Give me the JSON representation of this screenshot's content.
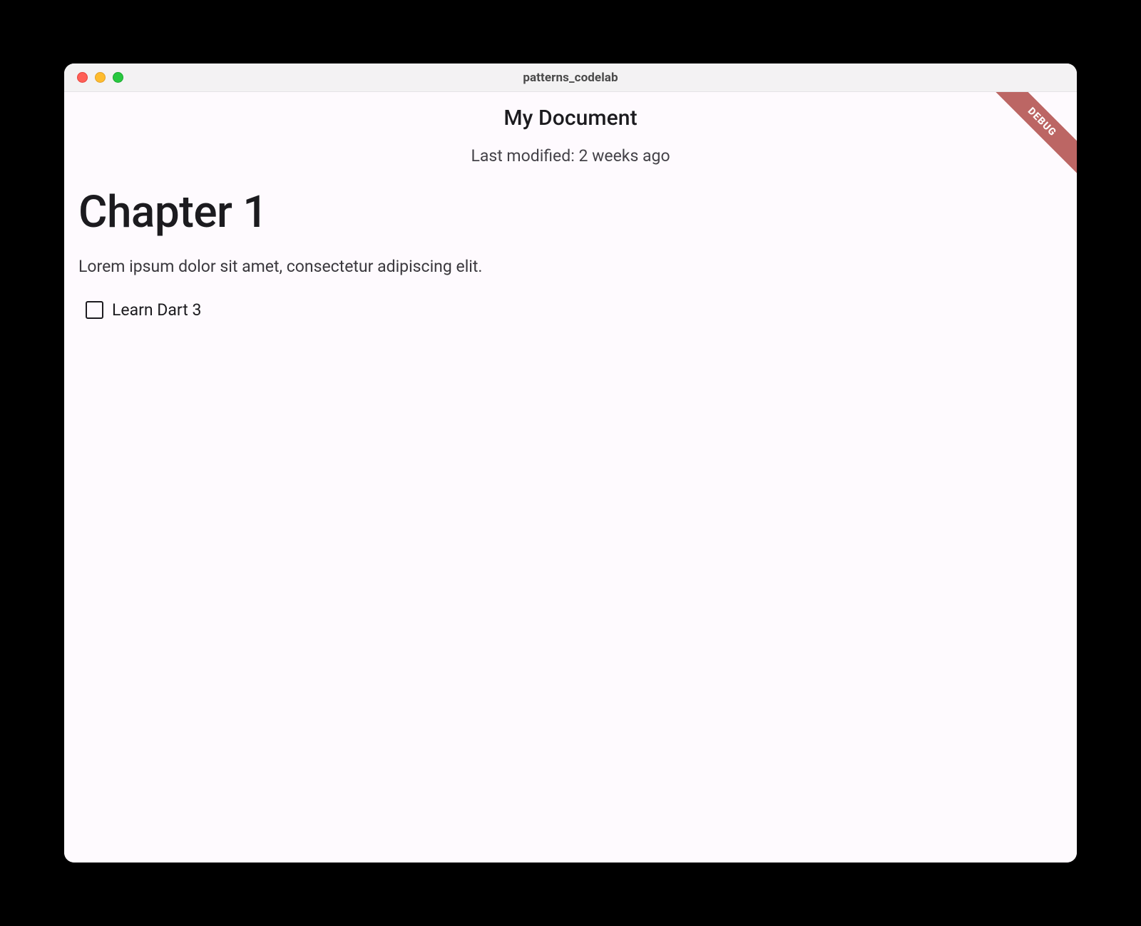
{
  "window": {
    "title": "patterns_codelab"
  },
  "appbar": {
    "title": "My Document"
  },
  "meta": {
    "last_modified": "Last modified: 2 weeks ago"
  },
  "blocks": {
    "heading": "Chapter 1",
    "paragraph": "Lorem ipsum dolor sit amet, consectetur adipiscing elit.",
    "checkbox_label": "Learn Dart 3",
    "checkbox_checked": false
  },
  "debug": {
    "banner_text": "DEBUG"
  },
  "colors": {
    "background": "#fefafe",
    "banner": "#bc6664"
  }
}
